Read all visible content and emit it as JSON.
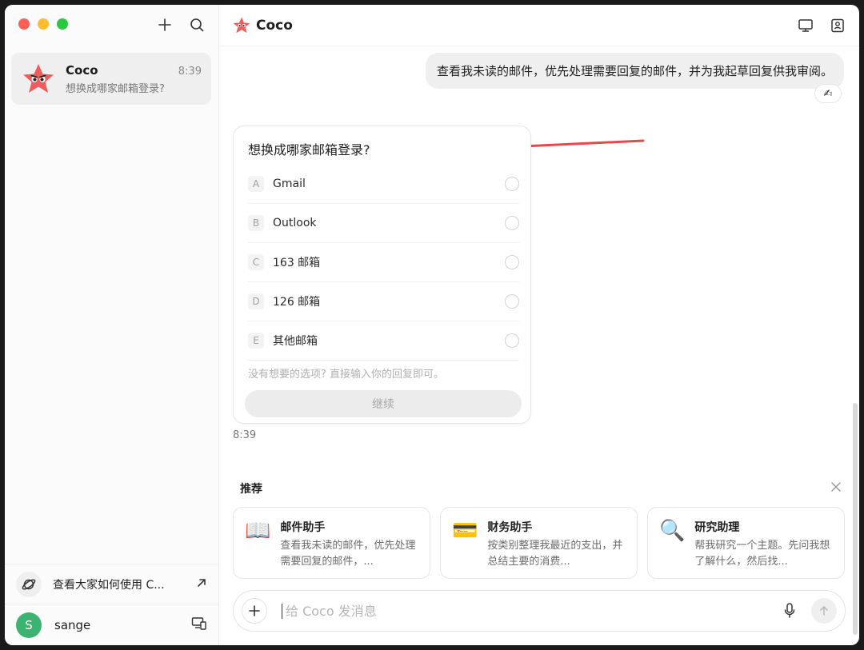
{
  "sidebar": {
    "new_chat_icon": "plus-icon",
    "search_icon": "search-icon",
    "chat": {
      "name": "Coco",
      "time": "8:39",
      "preview": "想换成哪家邮箱登录?"
    },
    "explore_label": "查看大家如何使用 C...",
    "user": {
      "initial": "S",
      "name": "sange"
    }
  },
  "header": {
    "title": "Coco"
  },
  "conversation": {
    "user_message": "查看我未读的邮件，优先处理需要回复的邮件，并为我起草回复供我审阅。",
    "reaction": "✍",
    "question": "想换成哪家邮箱登录?",
    "options": [
      {
        "key": "A",
        "label": "Gmail"
      },
      {
        "key": "B",
        "label": "Outlook"
      },
      {
        "key": "C",
        "label": "163 邮箱"
      },
      {
        "key": "D",
        "label": "126 邮箱"
      },
      {
        "key": "E",
        "label": "其他邮箱"
      }
    ],
    "hint": "没有想要的选项? 直接输入你的回复即可。",
    "continue_label": "继续",
    "time": "8:39"
  },
  "recommendations": {
    "title": "推荐",
    "items": [
      {
        "icon": "📖",
        "name": "邮件助手",
        "desc": "查看我未读的邮件，优先处理需要回复的邮件，..."
      },
      {
        "icon": "💳",
        "name": "财务助手",
        "desc": "按类别整理我最近的支出，并总结主要的消费..."
      },
      {
        "icon": "🔍",
        "name": "研究助理",
        "desc": "帮我研究一个主题。先问我想了解什么，然后找..."
      }
    ]
  },
  "composer": {
    "placeholder": "给 Coco 发消息"
  },
  "colors": {
    "accent_red": "#f15b5b",
    "arrow": "#e8474b",
    "user_green": "#3cb371"
  }
}
